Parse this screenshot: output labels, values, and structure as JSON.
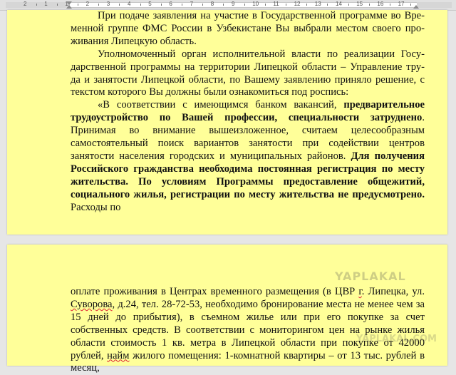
{
  "ruler": {
    "numbers": [
      "2",
      "1",
      "1",
      "2",
      "3",
      "4",
      "5",
      "6",
      "7",
      "8",
      "9",
      "10",
      "11",
      "12",
      "13",
      "14",
      "15",
      "16",
      "17"
    ]
  },
  "page1": {
    "line_1": "При подаче заявления на участие в Государственной программе во Вре-",
    "line_2": "менной группе ФМС России в Узбекистане Вы выбрали местом своего про-",
    "line_3": "живания Липецкую область.",
    "p2_line_1": "Уполномоченный орган исполнительной власти по реализации Госу-",
    "p2_line_2": "дарственной программы на территории Липецкой области – Управление тру-",
    "p2_line_3": "да и занятости Липецкой области, по Вашему заявлению приняло решение, с",
    "p2_line_4": "текстом которого Вы должны были ознакомиться под роспись:",
    "p3_a": "«В соответствии с имеющимся банком вакансий, ",
    "p3_b": "предварительное трудоустройство по Вашей профессии, специальности затруднено",
    "p3_c": ". Принимая во внимание вышеизложенное, считаем целесообразным самостоятельный поиск вариантов занятости при содействии центров занятости населения городских и муниципальных районов. ",
    "p3_d": "Для получения Российского гражданства необходима постоянная регистрация по месту жительства. По условиям Программы предоставление общежитий, социального жилья, регистрации по месту жительства не предусмотрено.",
    "p3_e": " Расходы по"
  },
  "page2": {
    "t1": "оплате проживания в Центрах временного размещения (в ЦВР ",
    "t2": "г",
    "t3": ". Липецка, ул. ",
    "t4": "Суворова",
    "t5": ", ",
    "t6": "д",
    "t7": ".24, тел. 28-72-53, необходимо бронирование места не менее чем за 15 дней до прибытия), в съемном жилье или при его покупке за счет собственных средств. В соответствии с мониторингом цен на рынке жилья  области стоимость 1 кв. метра в Липецкой области при покупке от 42000 рублей, ",
    "t8": "найм",
    "t9": " жилого помещения: 1-комнатной квартиры – от 13 тыс. рублей в месяц,"
  },
  "watermark": {
    "top": "YAPLAKAL",
    "bottom": "YAPLAKAL.COM"
  }
}
